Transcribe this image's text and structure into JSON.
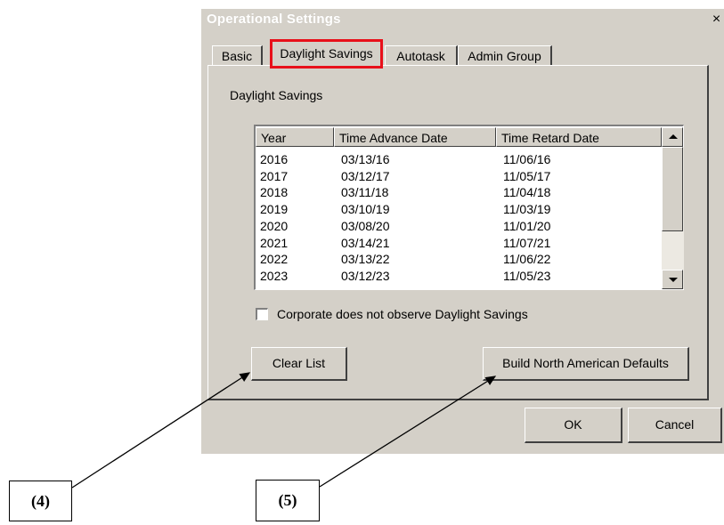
{
  "dialog": {
    "title": "Operational Settings",
    "close_glyph": "×"
  },
  "tabs": [
    {
      "label": "Basic"
    },
    {
      "label": "Daylight Savings"
    },
    {
      "label": "Autotask"
    },
    {
      "label": "Admin Group"
    }
  ],
  "group_label": "Daylight Savings",
  "list": {
    "headers": [
      "Year",
      "Time Advance Date",
      "Time Retard Date"
    ],
    "rows": [
      [
        "2016",
        "03/13/16",
        "11/06/16"
      ],
      [
        "2017",
        "03/12/17",
        "11/05/17"
      ],
      [
        "2018",
        "03/11/18",
        "11/04/18"
      ],
      [
        "2019",
        "03/10/19",
        "11/03/19"
      ],
      [
        "2020",
        "03/08/20",
        "11/01/20"
      ],
      [
        "2021",
        "03/14/21",
        "11/07/21"
      ],
      [
        "2022",
        "03/13/22",
        "11/06/22"
      ],
      [
        "2023",
        "03/12/23",
        "11/05/23"
      ]
    ]
  },
  "checkbox": {
    "label": "Corporate does not observe Daylight Savings",
    "checked": false
  },
  "buttons": {
    "clear_list": "Clear List",
    "build_defaults": "Build North American Defaults",
    "ok": "OK",
    "cancel": "Cancel"
  },
  "callouts": {
    "four": "(4)",
    "five": "(5)"
  },
  "colors": {
    "dialog_bg": "#d4d0c8",
    "highlight": "#e8101a"
  }
}
